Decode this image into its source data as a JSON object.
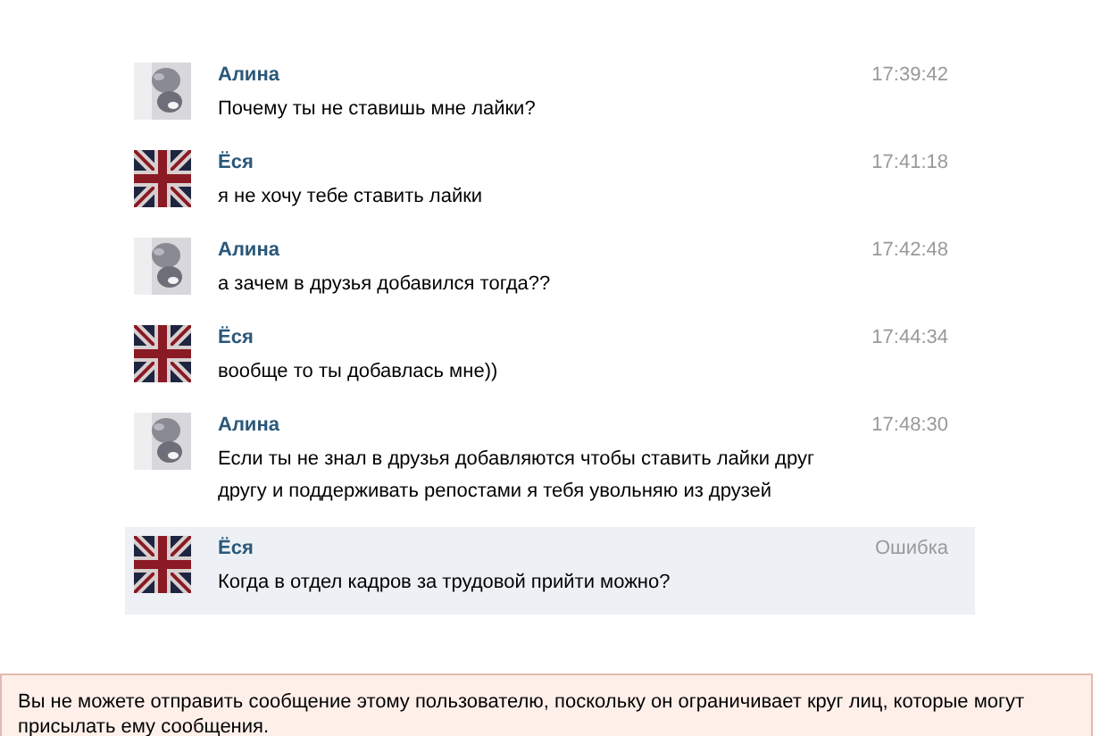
{
  "messages": [
    {
      "author": "Алина",
      "time": "17:39:42",
      "text": "Почему ты не ставишь мне лайки?",
      "highlighted": false
    },
    {
      "author": "Ёся",
      "kind": "flag",
      "time": "17:41:18",
      "text": "я не хочу тебе ставить лайки",
      "highlighted": false
    },
    {
      "author": "Алина",
      "time": "17:42:48",
      "text": "а зачем в друзья добавился тогда??",
      "highlighted": false
    },
    {
      "author": "Ёся",
      "kind": "flag",
      "time": "17:44:34",
      "text": "вообще то ты добавлась мне))",
      "highlighted": false
    },
    {
      "author": "Алина",
      "time": "17:48:30",
      "text": "Если ты не знал в друзья добавляются чтобы ставить лайки друг другу и поддерживать репостами я тебя увольняю из друзей",
      "highlighted": false
    },
    {
      "author": "Ёся",
      "kind": "flag",
      "time": "Ошибка",
      "text": "Когда в отдел кадров за трудовой прийти можно?",
      "highlighted": true
    }
  ],
  "notice": "Вы не можете отправить сообщение этому пользователю, поскольку он ограничивает круг лиц, которые могут присылать ему сообщения."
}
